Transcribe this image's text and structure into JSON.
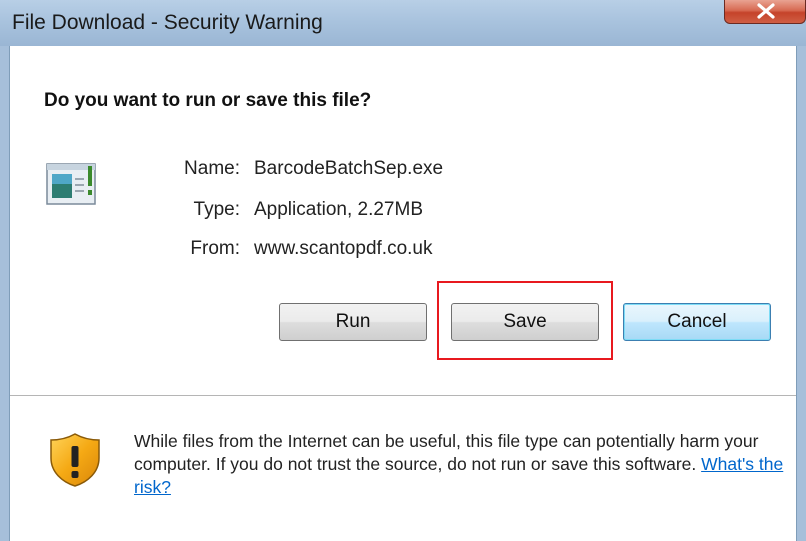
{
  "window": {
    "title": "File Download - Security Warning",
    "close_icon": "close-icon"
  },
  "dialog": {
    "question": "Do you want to run or save this file?",
    "file_icon": "application-icon",
    "fields": {
      "name_label": "Name:",
      "name_value": "BarcodeBatchSep.exe",
      "type_label": "Type:",
      "type_value": "Application, 2.27MB",
      "from_label": "From:",
      "from_value": "www.scantopdf.co.uk"
    },
    "buttons": {
      "run": "Run",
      "save": "Save",
      "cancel": "Cancel"
    },
    "highlight_color": "#e8191f"
  },
  "warning": {
    "icon": "shield-warning-icon",
    "text": "While files from the Internet can be useful, this file type can potentially harm your computer. If you do not trust the source, do not run or save this software.",
    "link": "What's the risk?"
  }
}
